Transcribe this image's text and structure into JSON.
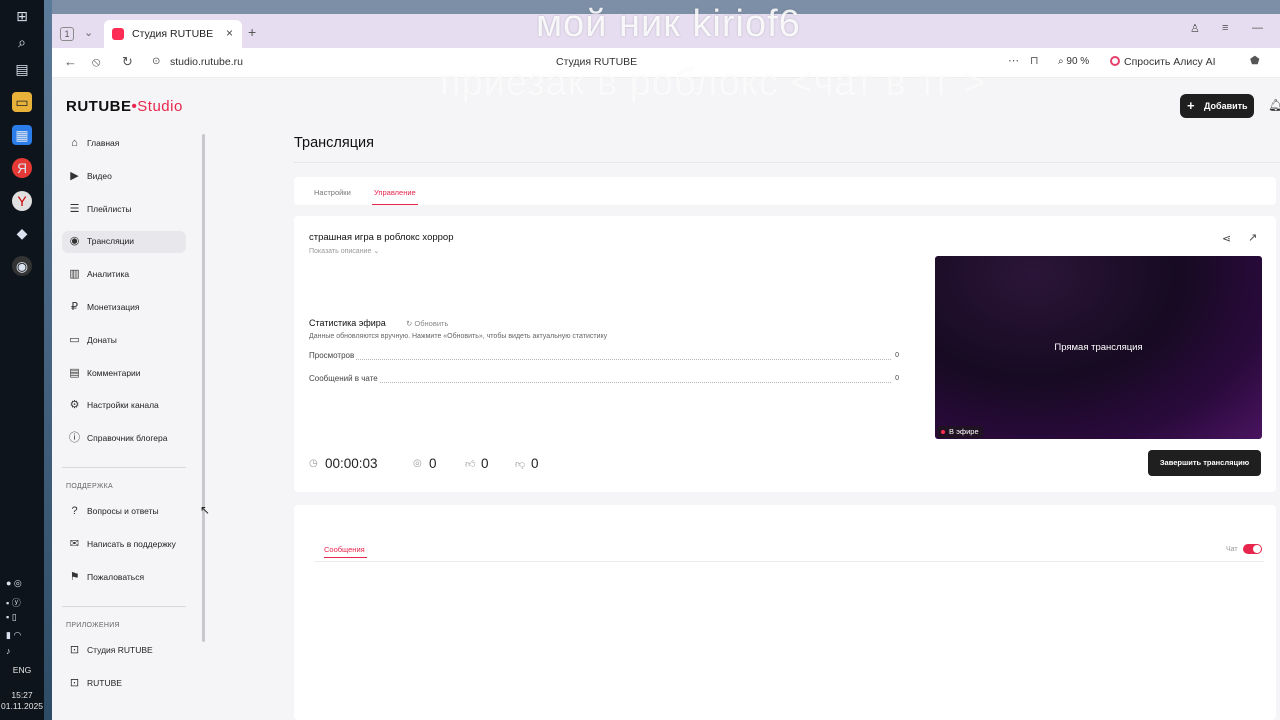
{
  "overlay": {
    "line1": "мой ник kiriof6",
    "line2": "приезак в роблокс <чат в тг >"
  },
  "taskbar": {
    "language": "ENG",
    "time": "15:27",
    "date": "01.11.2025"
  },
  "browser": {
    "tab_count": "1",
    "tab_title": "Студия RUTUBE",
    "url": "studio.rutube.ru",
    "page_title": "Студия RUTUBE",
    "zoom": "90 %",
    "alice_label": "Спросить Алису AI"
  },
  "app": {
    "logo_main": "RUTUBE",
    "logo_studio": "Studio",
    "add_label": "Добавить"
  },
  "sidebar": {
    "items": [
      {
        "label": "Главная",
        "icon": "home-icon"
      },
      {
        "label": "Видео",
        "icon": "video-icon"
      },
      {
        "label": "Плейлисты",
        "icon": "playlist-icon"
      },
      {
        "label": "Трансляции",
        "icon": "broadcast-icon"
      },
      {
        "label": "Аналитика",
        "icon": "analytics-icon"
      },
      {
        "label": "Монетизация",
        "icon": "ruble-icon"
      },
      {
        "label": "Донаты",
        "icon": "wallet-icon"
      },
      {
        "label": "Комментарии",
        "icon": "comment-icon"
      },
      {
        "label": "Настройки канала",
        "icon": "gear-icon"
      },
      {
        "label": "Справочник блогера",
        "icon": "info-icon"
      }
    ],
    "support_section": "ПОДДЕРЖКА",
    "support_items": [
      {
        "label": "Вопросы и ответы",
        "icon": "question-icon"
      },
      {
        "label": "Написать в поддержку",
        "icon": "mail-icon"
      },
      {
        "label": "Пожаловаться",
        "icon": "flag-icon"
      }
    ],
    "apps_section": "ПРИЛОЖЕНИЯ",
    "app_items": [
      {
        "label": "Студия RUTUBE",
        "icon": "studio-app-icon"
      },
      {
        "label": "RUTUBE",
        "icon": "rutube-app-icon"
      }
    ]
  },
  "main": {
    "page_title": "Трансляция",
    "tabs": [
      {
        "label": "Настройки"
      },
      {
        "label": "Управление"
      }
    ],
    "stream_title": "страшная игра в роблокс хоррор",
    "show_description": "Показать описание",
    "stats_title": "Статистика эфира",
    "refresh_label": "Обновить",
    "stats_hint": "Данные обновляются вручную. Нажмите «Обновить», чтобы видеть актуальную статистику",
    "stats": [
      {
        "label": "Просмотров",
        "value": "0"
      },
      {
        "label": "Сообщений в чате",
        "value": "0"
      }
    ],
    "timer": "00:00:03",
    "viewers": "0",
    "likes": "0",
    "dislikes": "0",
    "preview_label": "Прямая трансляция",
    "live_badge": "В эфире",
    "end_button": "Завершить трансляцию",
    "chat_tab": "Сообщения",
    "chat_toggle_label": "Чат"
  }
}
